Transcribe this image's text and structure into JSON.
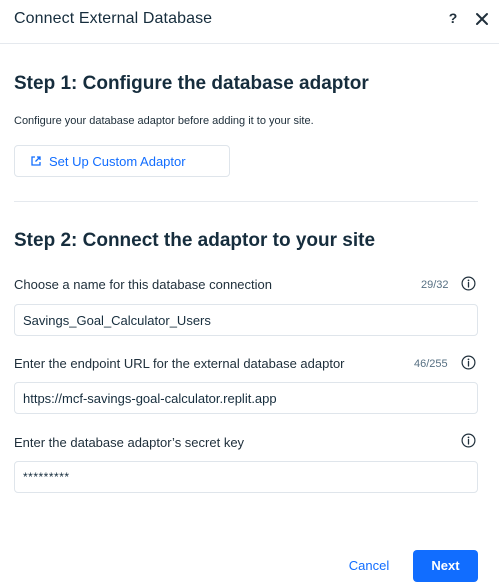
{
  "dialog": {
    "title": "Connect External Database",
    "help_label": "?",
    "close_label": "close"
  },
  "step1": {
    "title": "Step 1: Configure the database adaptor",
    "description": "Configure your database adaptor before adding it to your site.",
    "button_label": "Set Up Custom Adaptor"
  },
  "step2": {
    "title": "Step 2: Connect the adaptor to your site",
    "name_field": {
      "label": "Choose a name for this database connection",
      "counter": "29/32",
      "value": "Savings_Goal_Calculator_Users"
    },
    "url_field": {
      "label": "Enter the endpoint URL for the external database adaptor",
      "counter": "46/255",
      "value": "https://mcf-savings-goal-calculator.replit.app"
    },
    "secret_field": {
      "label": "Enter the database adaptor’s secret key",
      "value": "*********"
    }
  },
  "footer": {
    "cancel_label": "Cancel",
    "next_label": "Next"
  },
  "colors": {
    "accent": "#116dff",
    "text": "#162d3d",
    "border": "#dfe5eb"
  }
}
